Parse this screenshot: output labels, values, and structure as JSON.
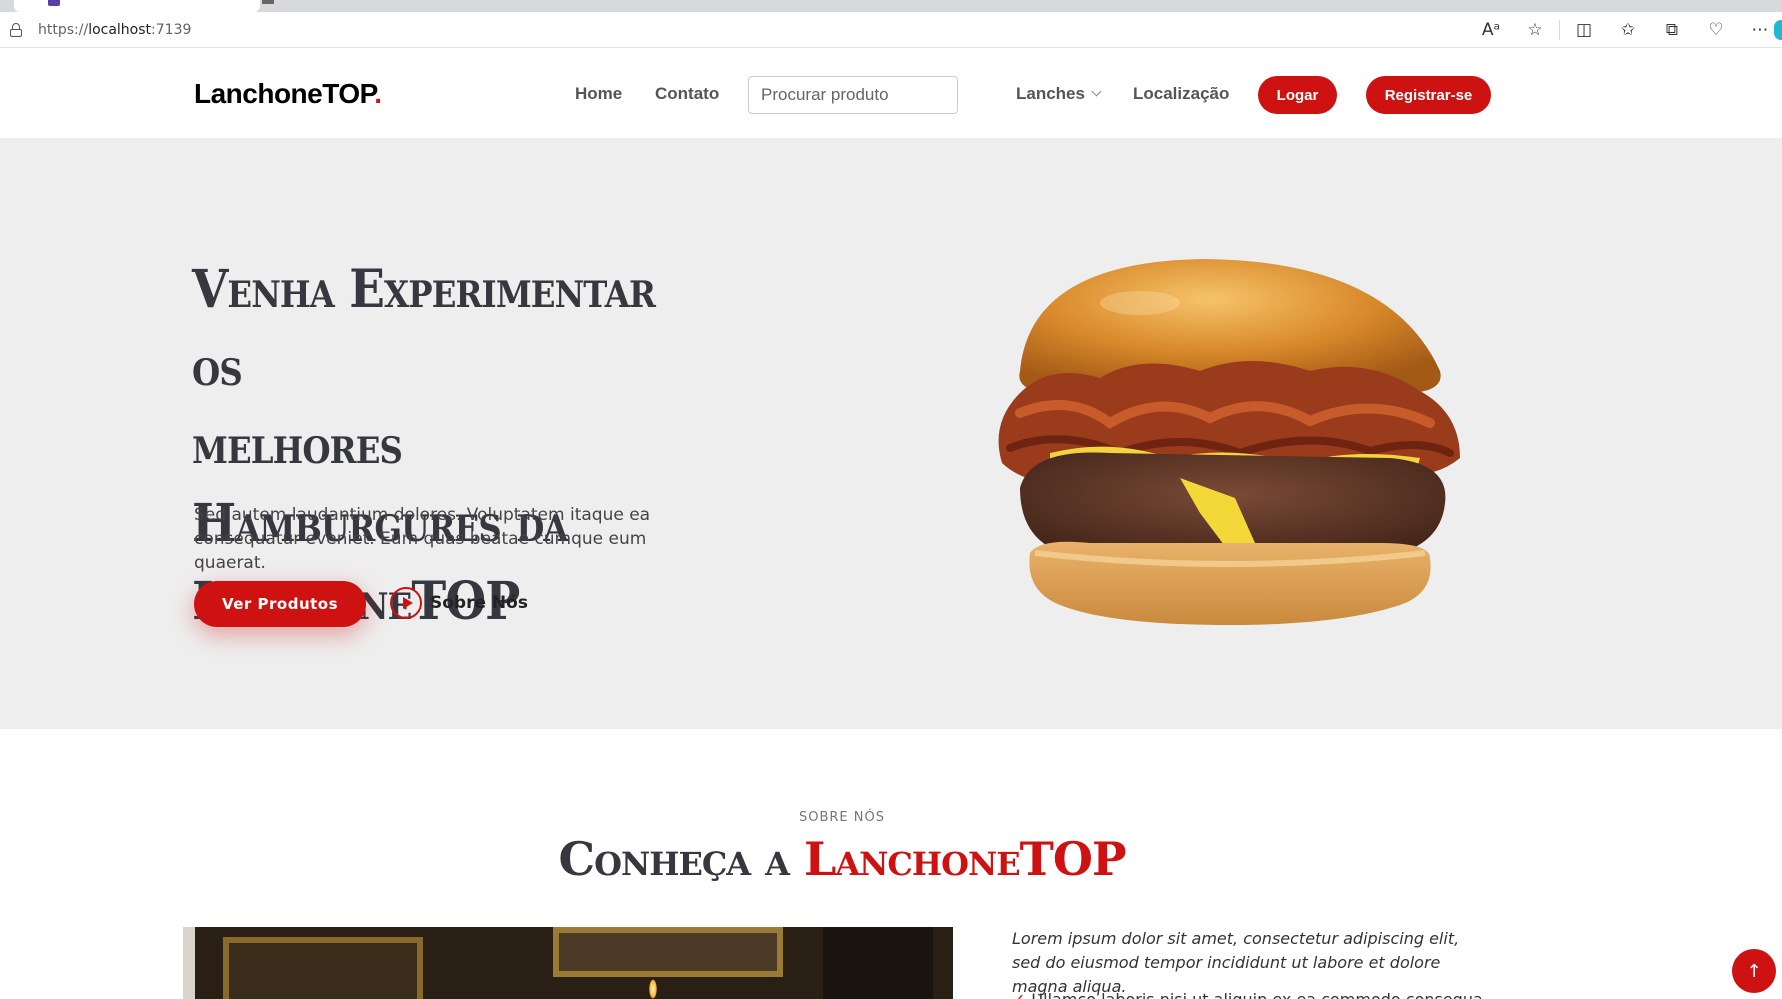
{
  "browser": {
    "url_scheme": "https://",
    "url_host": "localhost",
    "url_port": ":7139",
    "toolbar_icons": [
      "read-aloud-icon",
      "favorite-star-icon",
      "split-screen-icon",
      "favorites-icon",
      "collections-icon",
      "browser-essentials-icon",
      "more-icon"
    ]
  },
  "header": {
    "logo_text": "LanchoneTOP",
    "logo_dot": ".",
    "nav": {
      "home": "Home",
      "contact": "Contato",
      "snacks": "Lanches",
      "location": "Localização"
    },
    "search_placeholder": "Procurar produto",
    "login_label": "Logar",
    "register_label": "Registrar-se"
  },
  "hero": {
    "title_line1": "Venha Experimentar os",
    "title_line2": "melhores Hamburgures da",
    "title_line3": "LanchoneTOP",
    "text": "Sed autem laudantium dolores. Voluptatem itaque ea consequatur eveniet. Eum quas beatae cumque eum quaerat.",
    "cta_label": "Ver Produtos",
    "about_label": "Sobre Nós"
  },
  "about": {
    "subtitle": "SOBRE NÓS",
    "title_prefix": "Conheça a",
    "title_accent": "LanchoneTOP",
    "lead": "Lorem ipsum dolor sit amet, consectetur adipiscing elit, sed do eiusmod tempor incididunt ut labore et dolore magna aliqua.",
    "bullet_1": "Ullamco laboris nisi ut aliquip ex ea commodo consequat."
  },
  "colors": {
    "accent": "#ce1212",
    "hero_bg": "#eeeeee",
    "heading": "#37373f"
  }
}
